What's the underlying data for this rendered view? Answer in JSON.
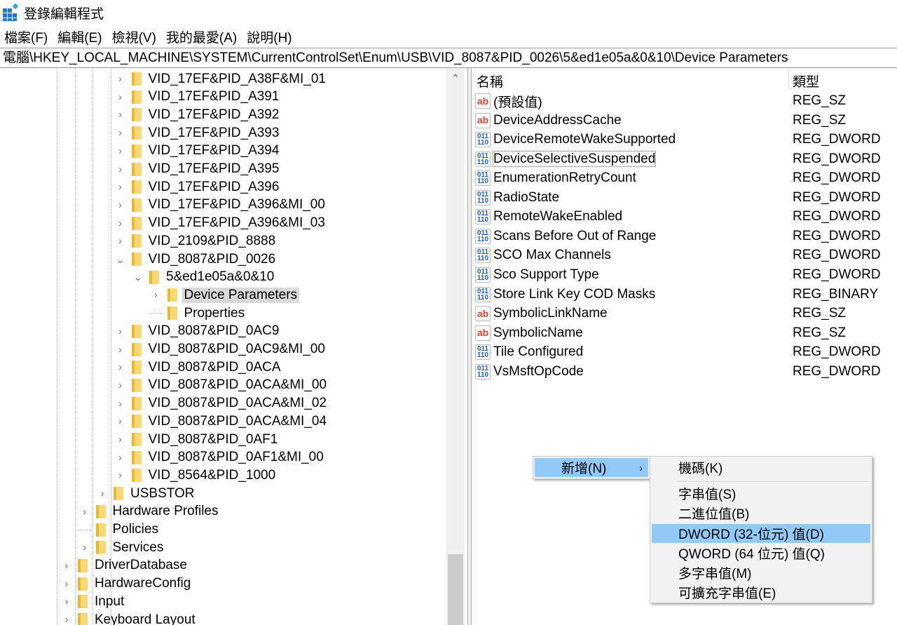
{
  "window": {
    "title": "登錄編輯程式",
    "icon": "registry-editor-icon"
  },
  "menu": [
    "檔案(F)",
    "編輯(E)",
    "檢視(V)",
    "我的最愛(A)",
    "說明(H)"
  ],
  "address": "電腦\\HKEY_LOCAL_MACHINE\\SYSTEM\\CurrentControlSet\\Enum\\USB\\VID_8087&PID_0026\\5&ed1e05a&0&10\\Device Parameters",
  "tree": [
    {
      "label": "VID_17EF&PID_A38F&MI_01",
      "level": 4,
      "expander": "collapsed"
    },
    {
      "label": "VID_17EF&PID_A391",
      "level": 4,
      "expander": "collapsed"
    },
    {
      "label": "VID_17EF&PID_A392",
      "level": 4,
      "expander": "collapsed"
    },
    {
      "label": "VID_17EF&PID_A393",
      "level": 4,
      "expander": "collapsed"
    },
    {
      "label": "VID_17EF&PID_A394",
      "level": 4,
      "expander": "collapsed"
    },
    {
      "label": "VID_17EF&PID_A395",
      "level": 4,
      "expander": "collapsed"
    },
    {
      "label": "VID_17EF&PID_A396",
      "level": 4,
      "expander": "collapsed"
    },
    {
      "label": "VID_17EF&PID_A396&MI_00",
      "level": 4,
      "expander": "collapsed"
    },
    {
      "label": "VID_17EF&PID_A396&MI_03",
      "level": 4,
      "expander": "collapsed"
    },
    {
      "label": "VID_2109&PID_8888",
      "level": 4,
      "expander": "collapsed"
    },
    {
      "label": "VID_8087&PID_0026",
      "level": 4,
      "expander": "expanded"
    },
    {
      "label": "5&ed1e05a&0&10",
      "level": 5,
      "expander": "expanded"
    },
    {
      "label": "Device Parameters",
      "level": 6,
      "expander": "collapsed",
      "selected": true
    },
    {
      "label": "Properties",
      "level": 6,
      "expander": "none"
    },
    {
      "label": "VID_8087&PID_0AC9",
      "level": 4,
      "expander": "collapsed"
    },
    {
      "label": "VID_8087&PID_0AC9&MI_00",
      "level": 4,
      "expander": "collapsed"
    },
    {
      "label": "VID_8087&PID_0ACA",
      "level": 4,
      "expander": "collapsed"
    },
    {
      "label": "VID_8087&PID_0ACA&MI_00",
      "level": 4,
      "expander": "collapsed"
    },
    {
      "label": "VID_8087&PID_0ACA&MI_02",
      "level": 4,
      "expander": "collapsed"
    },
    {
      "label": "VID_8087&PID_0ACA&MI_04",
      "level": 4,
      "expander": "collapsed"
    },
    {
      "label": "VID_8087&PID_0AF1",
      "level": 4,
      "expander": "collapsed"
    },
    {
      "label": "VID_8087&PID_0AF1&MI_00",
      "level": 4,
      "expander": "collapsed"
    },
    {
      "label": "VID_8564&PID_1000",
      "level": 4,
      "expander": "collapsed"
    },
    {
      "label": "USBSTOR",
      "level": 3,
      "expander": "collapsed"
    },
    {
      "label": "Hardware Profiles",
      "level": 2,
      "expander": "collapsed"
    },
    {
      "label": "Policies",
      "level": 2,
      "expander": "none"
    },
    {
      "label": "Services",
      "level": 2,
      "expander": "collapsed"
    },
    {
      "label": "DriverDatabase",
      "level": 1,
      "expander": "collapsed"
    },
    {
      "label": "HardwareConfig",
      "level": 1,
      "expander": "collapsed"
    },
    {
      "label": "Input",
      "level": 1,
      "expander": "collapsed"
    },
    {
      "label": "Keyboard Layout",
      "level": 1,
      "expander": "collapsed"
    }
  ],
  "list": {
    "headers": {
      "name": "名稱",
      "type": "類型"
    },
    "rows": [
      {
        "name": "(預設值)",
        "type": "REG_SZ"
      },
      {
        "name": "DeviceAddressCache",
        "type": "REG_SZ"
      },
      {
        "name": "DeviceRemoteWakeSupported",
        "type": "REG_DWORD"
      },
      {
        "name": "DeviceSelectiveSuspended",
        "type": "REG_DWORD",
        "focused": true
      },
      {
        "name": "EnumerationRetryCount",
        "type": "REG_DWORD"
      },
      {
        "name": "RadioState",
        "type": "REG_DWORD"
      },
      {
        "name": "RemoteWakeEnabled",
        "type": "REG_DWORD"
      },
      {
        "name": "Scans Before Out of Range",
        "type": "REG_DWORD"
      },
      {
        "name": "SCO Max Channels",
        "type": "REG_DWORD"
      },
      {
        "name": "Sco Support Type",
        "type": "REG_DWORD"
      },
      {
        "name": "Store Link Key COD Masks",
        "type": "REG_BINARY"
      },
      {
        "name": "SymbolicLinkName",
        "type": "REG_SZ"
      },
      {
        "name": "SymbolicName",
        "type": "REG_SZ"
      },
      {
        "name": "Tile Configured",
        "type": "REG_DWORD"
      },
      {
        "name": "VsMsftOpCode",
        "type": "REG_DWORD"
      }
    ]
  },
  "context_menu": {
    "item": "新增(N)",
    "arrow": "›"
  },
  "submenu": [
    {
      "label": "機碼(K)"
    },
    {
      "separator": true
    },
    {
      "label": "字串值(S)"
    },
    {
      "label": "二進位值(B)"
    },
    {
      "label": "DWORD (32-位元) 值(D)",
      "highlighted": true
    },
    {
      "label": "QWORD (64 位元) 值(Q)"
    },
    {
      "label": "多字串值(M)"
    },
    {
      "label": "可擴充字串值(E)"
    }
  ],
  "colors": {
    "highlight": "#91c9f7",
    "selection": "#d9d9d9",
    "folder": "#f8d775",
    "string_icon": "#d9452b",
    "binary_icon": "#1c5fc4"
  }
}
